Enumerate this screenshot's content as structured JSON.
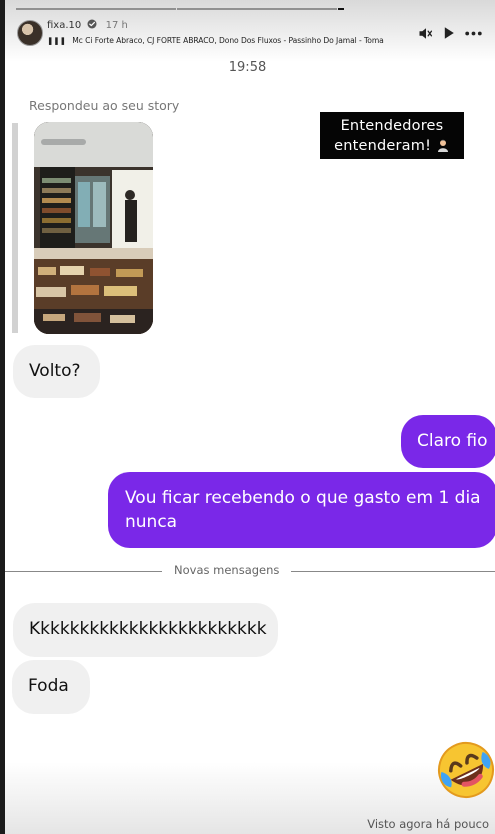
{
  "story": {
    "username": "fixa.10",
    "age": "17 h",
    "music": "Mc Ci Forte Abraco, CJ FORTE ABRACO, Dono Dos Fluxos - Passinho Do Jamal - Toma",
    "icons": [
      "verified-icon",
      "mute-icon",
      "play-icon",
      "more-icon"
    ]
  },
  "chat": {
    "time": "19:58",
    "reply_label": "Respondeu ao seu story",
    "sticker_line1": "Entendedores",
    "sticker_line2": "entenderam!",
    "messages": [
      {
        "from": "them",
        "text": "Volto?"
      },
      {
        "from": "me",
        "text": "Claro fio"
      },
      {
        "from": "me",
        "text": "Vou ficar recebendo o que gasto em 1 dia nunca"
      },
      {
        "from": "them",
        "text": "Kkkkkkkkkkkkkkkkkkkkkkkk"
      },
      {
        "from": "them",
        "text": "Foda"
      }
    ],
    "divider": "Novas mensagens",
    "reaction_icon": "rolling-laughing-emoji",
    "seen_status": "Visto agora há pouco"
  },
  "colors": {
    "outgoing": "#7a28e8",
    "incoming": "#f0f0f0",
    "sticker_bg": "#050505"
  }
}
